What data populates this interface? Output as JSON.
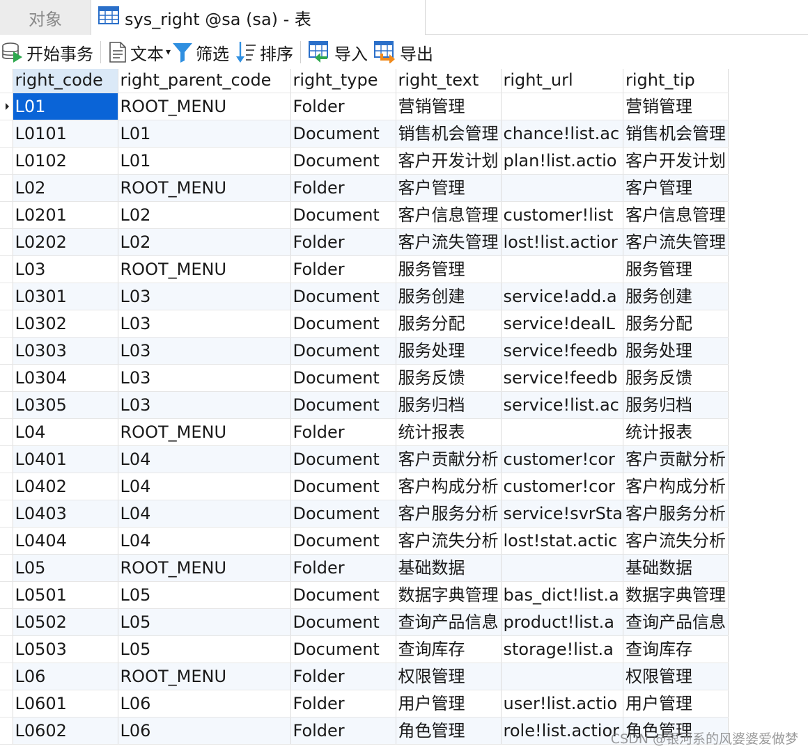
{
  "tabs": {
    "objects_label": "对象",
    "active_label": "sys_right @sa (sa) - 表"
  },
  "toolbar": {
    "begin_transaction": "开始事务",
    "text": "文本",
    "filter": "筛选",
    "sort": "排序",
    "import": "导入",
    "export": "导出"
  },
  "columns": [
    "right_code",
    "right_parent_code",
    "right_type",
    "right_text",
    "right_url",
    "right_tip"
  ],
  "rows": [
    [
      "L01",
      "ROOT_MENU",
      "Folder",
      "营销管理",
      "",
      "营销管理"
    ],
    [
      "L0101",
      "L01",
      "Document",
      "销售机会管理",
      "chance!list.ac",
      "销售机会管理"
    ],
    [
      "L0102",
      "L01",
      "Document",
      "客户开发计划",
      "plan!list.actio",
      "客户开发计划"
    ],
    [
      "L02",
      "ROOT_MENU",
      "Folder",
      "客户管理",
      "",
      "客户管理"
    ],
    [
      "L0201",
      "L02",
      "Document",
      "客户信息管理",
      "customer!list",
      "客户信息管理"
    ],
    [
      "L0202",
      "L02",
      "Folder",
      "客户流失管理",
      "lost!list.actior",
      "客户流失管理"
    ],
    [
      "L03",
      "ROOT_MENU",
      "Folder",
      "服务管理",
      "",
      "服务管理"
    ],
    [
      "L0301",
      "L03",
      "Document",
      "服务创建",
      "service!add.a",
      "服务创建"
    ],
    [
      "L0302",
      "L03",
      "Document",
      "服务分配",
      "service!dealL",
      "服务分配"
    ],
    [
      "L0303",
      "L03",
      "Document",
      "服务处理",
      "service!feedb",
      "服务处理"
    ],
    [
      "L0304",
      "L03",
      "Document",
      "服务反馈",
      "service!feedb",
      "服务反馈"
    ],
    [
      "L0305",
      "L03",
      "Document",
      "服务归档",
      "service!list.ac",
      "服务归档"
    ],
    [
      "L04",
      "ROOT_MENU",
      "Folder",
      "统计报表",
      "",
      "统计报表"
    ],
    [
      "L0401",
      "L04",
      "Document",
      "客户贡献分析",
      "customer!cor",
      "客户贡献分析"
    ],
    [
      "L0402",
      "L04",
      "Document",
      "客户构成分析",
      "customer!cor",
      "客户构成分析"
    ],
    [
      "L0403",
      "L04",
      "Document",
      "客户服务分析",
      "service!svrSta",
      "客户服务分析"
    ],
    [
      "L0404",
      "L04",
      "Document",
      "客户流失分析",
      "lost!stat.actic",
      "客户流失分析"
    ],
    [
      "L05",
      "ROOT_MENU",
      "Folder",
      "基础数据",
      "",
      "基础数据"
    ],
    [
      "L0501",
      "L05",
      "Document",
      "数据字典管理",
      "bas_dict!list.a",
      "数据字典管理"
    ],
    [
      "L0502",
      "L05",
      "Document",
      "查询产品信息",
      "product!list.a",
      "查询产品信息"
    ],
    [
      "L0503",
      "L05",
      "Document",
      "查询库存",
      "storage!list.a",
      "查询库存"
    ],
    [
      "L06",
      "ROOT_MENU",
      "Folder",
      "权限管理",
      "",
      "权限管理"
    ],
    [
      "L0601",
      "L06",
      "Folder",
      "用户管理",
      "user!list.actio",
      "用户管理"
    ],
    [
      "L0602",
      "L06",
      "Folder",
      "角色管理",
      "role!list.actior",
      "角色管理"
    ]
  ],
  "watermark": "CSDN @银河系的风婆婆爱做梦",
  "colors": {
    "selection": "#0a64d7",
    "header_selected": "#dbe9f7",
    "row_alt": "#f4f8fd",
    "filter_icon": "#2f8fe0"
  }
}
